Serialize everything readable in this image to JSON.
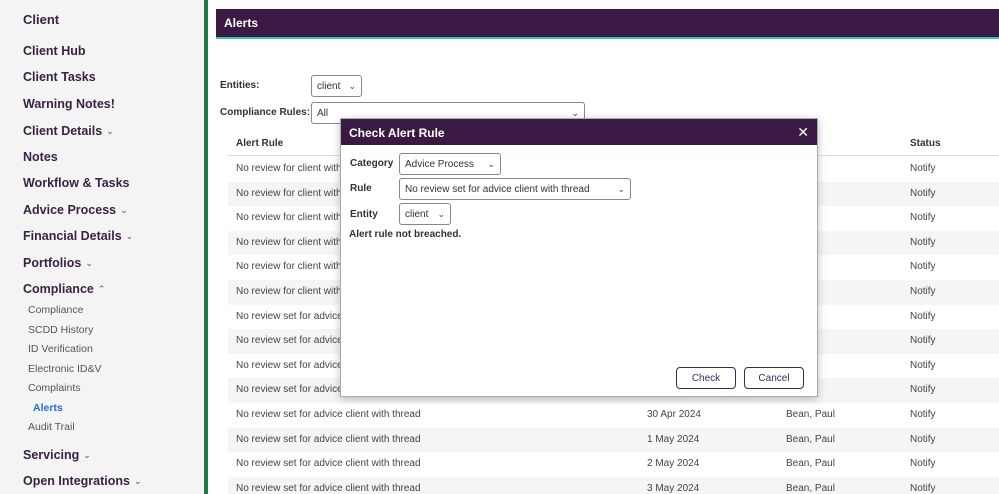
{
  "sidebar": {
    "title": "Client",
    "items": [
      {
        "label": "Client Hub",
        "chevron": ""
      },
      {
        "label": "Client Tasks",
        "chevron": ""
      },
      {
        "label": "Warning Notes!",
        "chevron": ""
      },
      {
        "label": "Client Details",
        "chevron": "⌄"
      },
      {
        "label": "Notes",
        "chevron": ""
      },
      {
        "label": "Workflow & Tasks",
        "chevron": ""
      },
      {
        "label": "Advice Process",
        "chevron": "⌄"
      },
      {
        "label": "Financial Details",
        "chevron": "⌄"
      },
      {
        "label": "Portfolios",
        "chevron": "⌄"
      },
      {
        "label": "Compliance",
        "chevron": "⌃"
      }
    ],
    "compliance_sub": [
      "Compliance",
      "SCDD History",
      "ID Verification",
      "Electronic ID&V",
      "Complaints",
      "Alerts",
      "Audit Trail"
    ],
    "after_items": [
      {
        "label": "Servicing",
        "chevron": "⌄"
      },
      {
        "label": "Open Integrations",
        "chevron": "⌄"
      }
    ]
  },
  "main": {
    "header": "Alerts",
    "entities_label": "Entities:",
    "entities_value": "client",
    "compliance_rules_label": "Compliance Rules:",
    "compliance_rules_value": "All"
  },
  "table": {
    "columns": [
      "Alert Rule",
      "Status"
    ],
    "rows": [
      {
        "rule": "No review for client with",
        "date": "",
        "user": "aul",
        "status": "Notify"
      },
      {
        "rule": "No review for client with",
        "date": "",
        "user": "aul",
        "status": "Notify"
      },
      {
        "rule": "No review for client with",
        "date": "",
        "user": "aul",
        "status": "Notify"
      },
      {
        "rule": "No review for client with",
        "date": "",
        "user": "aul",
        "status": "Notify"
      },
      {
        "rule": "No review for client with",
        "date": "",
        "user": "aul",
        "status": "Notify"
      },
      {
        "rule": "No review for client with",
        "date": "",
        "user": "aul",
        "status": "Notify"
      },
      {
        "rule": "No review set for advice",
        "date": "",
        "user": "aul",
        "status": "Notify"
      },
      {
        "rule": "No review set for advice",
        "date": "",
        "user": "aul",
        "status": "Notify"
      },
      {
        "rule": "No review set for advice",
        "date": "",
        "user": "aul",
        "status": "Notify"
      },
      {
        "rule": "No review set for advice",
        "date": "",
        "user": "aul",
        "status": "Notify"
      },
      {
        "rule": "No review set for advice client with thread",
        "date": "30 Apr 2024",
        "user": "Bean, Paul",
        "status": "Notify"
      },
      {
        "rule": "No review set for advice client with thread",
        "date": "1 May 2024",
        "user": "Bean, Paul",
        "status": "Notify"
      },
      {
        "rule": "No review set for advice client with thread",
        "date": "2 May 2024",
        "user": "Bean, Paul",
        "status": "Notify"
      },
      {
        "rule": "No review set for advice client with thread",
        "date": "3 May 2024",
        "user": "Bean, Paul",
        "status": "Notify"
      }
    ]
  },
  "modal": {
    "title": "Check Alert Rule",
    "close_glyph": "✕",
    "category_label": "Category",
    "category_value": "Advice Process",
    "rule_label": "Rule",
    "rule_value": "No review set for advice client with thread",
    "entity_label": "Entity",
    "entity_value": "client",
    "result": "Alert rule not breached.",
    "check_label": "Check",
    "cancel_label": "Cancel"
  },
  "colors": {
    "header_bg": "#3a1a42",
    "accent_line": "#3cc8a8",
    "sidebar_border": "#1e7a43",
    "active_link": "#1f6fd6"
  },
  "icons": {
    "caret": "⌄"
  }
}
